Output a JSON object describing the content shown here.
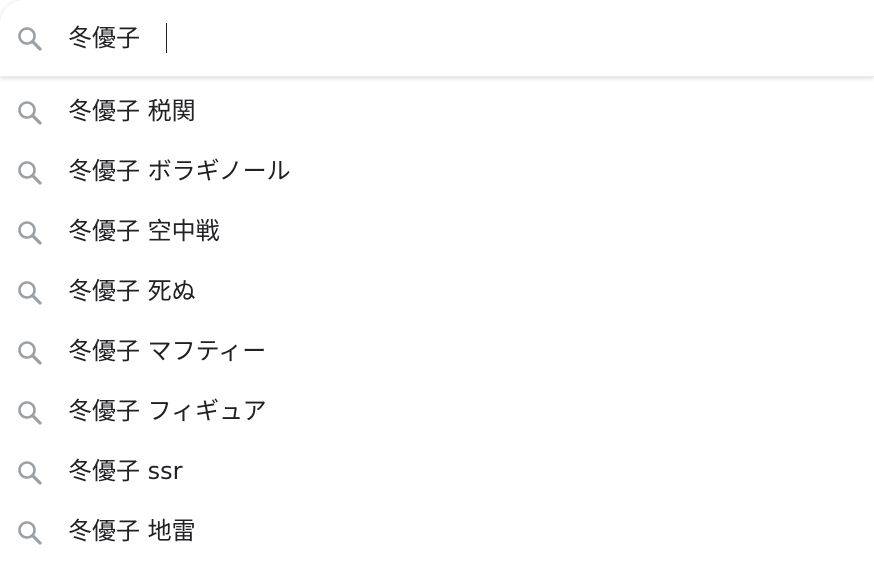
{
  "search": {
    "icon": "search-icon",
    "query": "冬優子"
  },
  "suggestions": [
    {
      "icon": "search-icon",
      "text": "冬優子 税関"
    },
    {
      "icon": "search-icon",
      "text": "冬優子 ボラギノール"
    },
    {
      "icon": "search-icon",
      "text": "冬優子 空中戦"
    },
    {
      "icon": "search-icon",
      "text": "冬優子 死ぬ"
    },
    {
      "icon": "search-icon",
      "text": "冬優子 マフティー"
    },
    {
      "icon": "search-icon",
      "text": "冬優子 フィギュア"
    },
    {
      "icon": "search-icon",
      "text": "冬優子 ssr"
    },
    {
      "icon": "search-icon",
      "text": "冬優子 地雷"
    }
  ],
  "colors": {
    "icon": "#9aa0a6",
    "text": "#202124",
    "background": "#ffffff",
    "divider": "#e8eaed"
  }
}
